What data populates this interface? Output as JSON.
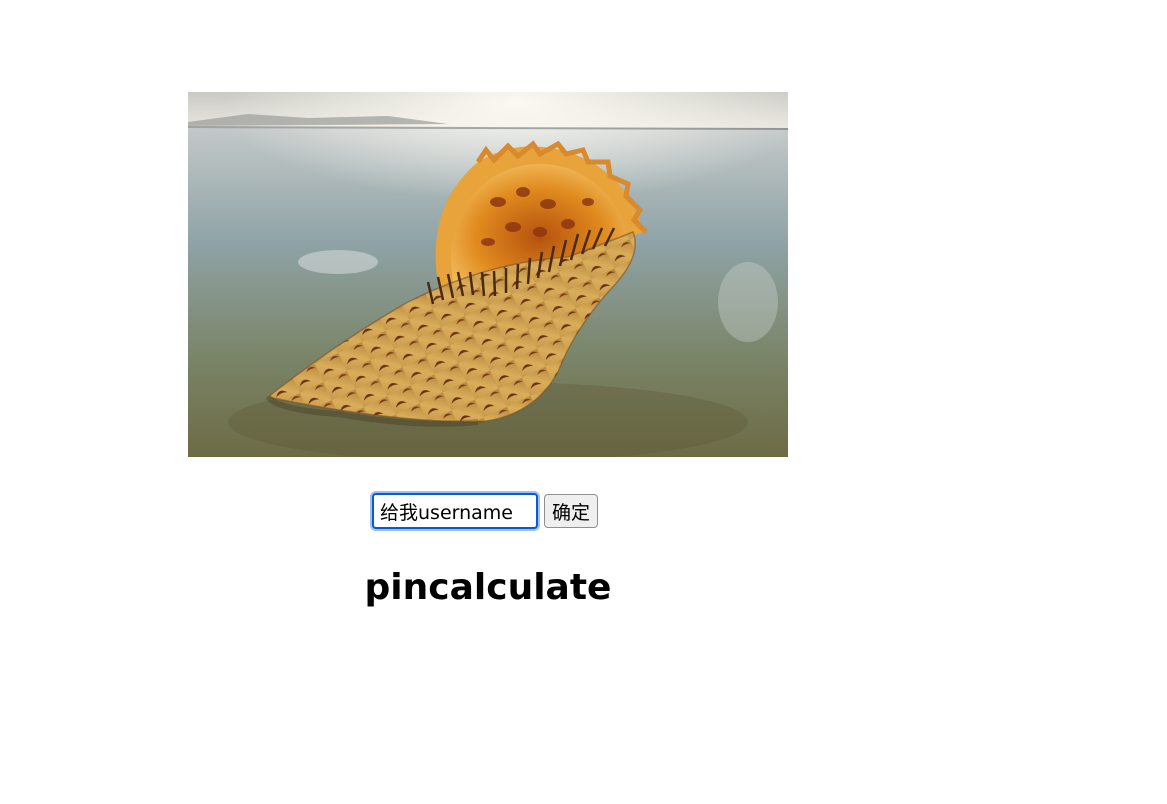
{
  "image": {
    "alt": "",
    "icon": "shell-photo"
  },
  "form": {
    "input_value": "给我username",
    "submit_label": "确定"
  },
  "result": {
    "text": "pincalculate"
  }
}
